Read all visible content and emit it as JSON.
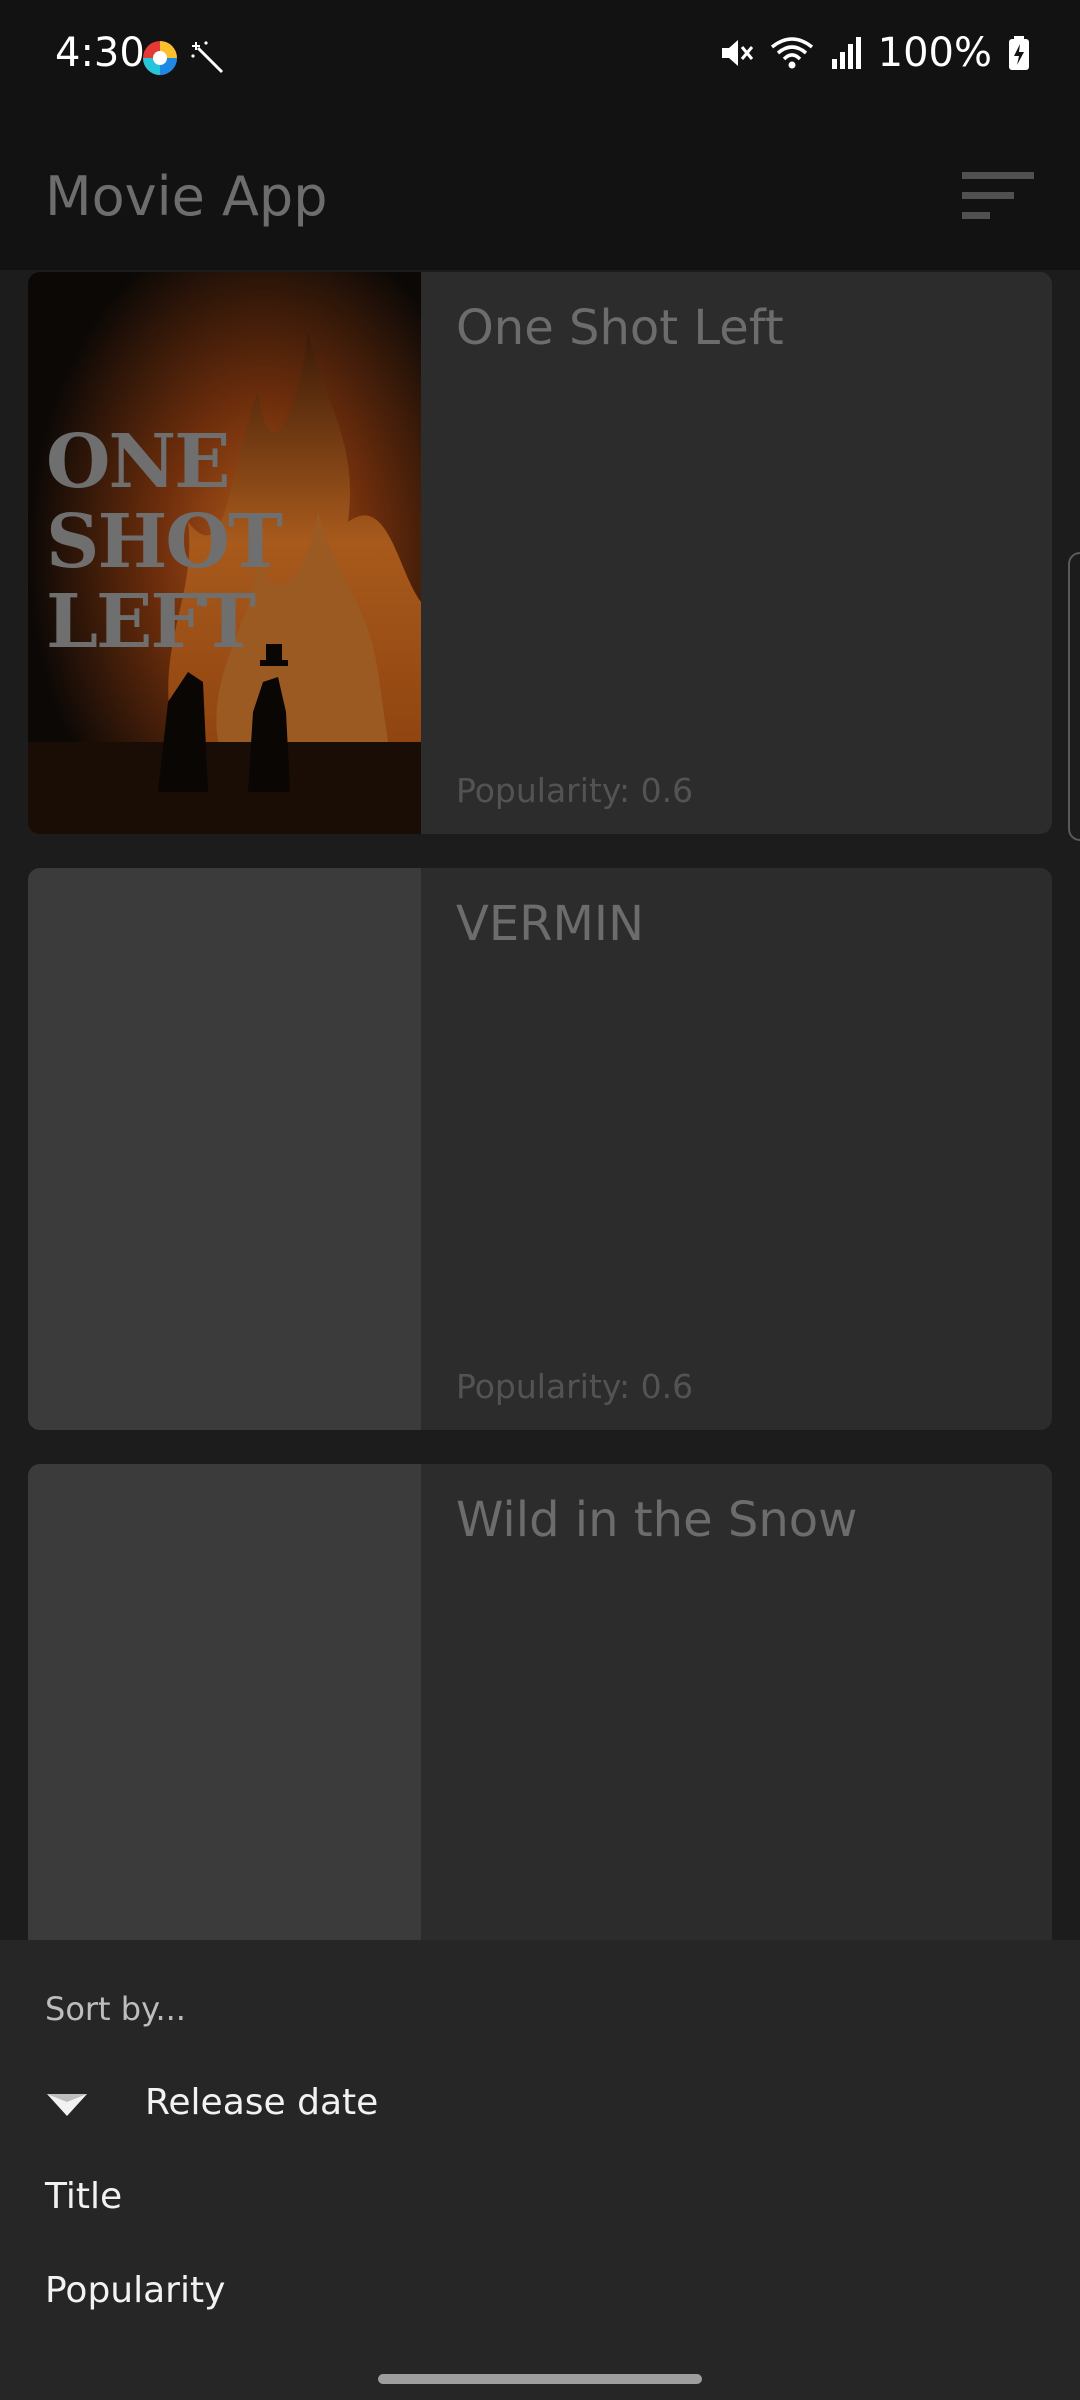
{
  "status_bar": {
    "time": "4:30",
    "battery": "100%",
    "icons": [
      "color-wheel-icon",
      "magic-wand-icon",
      "mute-icon",
      "wifi-icon",
      "signal-icon",
      "battery-charging-icon"
    ]
  },
  "app_bar": {
    "title": "Movie App",
    "sort_icon": "sort-icon"
  },
  "movies": [
    {
      "title": "One Shot Left",
      "popularity": "Popularity: 0.6",
      "poster_text": [
        "ONE",
        "SHOT",
        "LEFT"
      ]
    },
    {
      "title": "VERMIN",
      "popularity": "Popularity: 0.6"
    },
    {
      "title": "Wild in the Snow",
      "popularity": ""
    }
  ],
  "sort_sheet": {
    "header": "Sort by...",
    "options": [
      "Release date",
      "Title",
      "Popularity"
    ],
    "selected": "Release date",
    "selected_icon": "triangle-down-icon"
  }
}
